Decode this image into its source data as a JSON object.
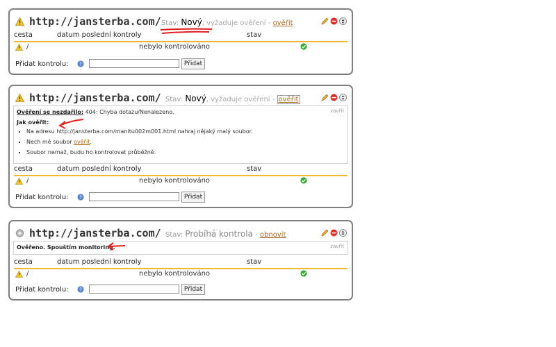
{
  "columns": {
    "path": "cesta",
    "last_check": "datum poslední kontroly",
    "state": "stav"
  },
  "add_check": {
    "label": "Přidat kontrolu:",
    "button": "Přidat",
    "input_value": ""
  },
  "colors": {
    "accent": "#f1b733",
    "link": "#a86a1e",
    "annotation": "#e0201e",
    "ok": "#3aaa35",
    "danger": "#d9302a"
  },
  "panels": [
    {
      "url": "http://jansterba.com/",
      "status_icon": "warning-icon",
      "state_label": "Stav:",
      "state_value": "Nový",
      "state_sep": ", vyžaduje ověření -",
      "state_action": "ověřit",
      "row": {
        "path": "/",
        "last_check": "nebylo kontrolováno"
      }
    },
    {
      "url": "http://jansterba.com/",
      "status_icon": "warning-icon",
      "state_label": "Stav:",
      "state_value": "Nový",
      "state_sep": ", vyžaduje ověření -",
      "state_action": "ověřit",
      "message": {
        "title": "Ověření se nezdařilo:",
        "error": "404: Chyba dotazu/Nenalezeno.",
        "close": "zavřít",
        "how_title": "Jak ověřit:",
        "steps": [
          "Na adresu http://jansterba.com/manitu002m001.html nahraj nějaký malý soubor.",
          "Nech mě soubor",
          "Soubor nemaž, budu ho kontrolovat průběžně."
        ],
        "step2_link": "ověřit",
        "step2_end": "."
      },
      "row": {
        "path": "/",
        "last_check": "nebylo kontrolováno"
      }
    },
    {
      "url": "http://jansterba.com/",
      "status_icon": "pending-icon",
      "state_label": "Stav:",
      "state_value": "Probíhá kontrola",
      "state_sep": "-",
      "state_action": "obnovit",
      "message": {
        "text": "Ověřeno. Spouštím monitoring.",
        "close": "zavřít"
      },
      "row": {
        "path": "/",
        "last_check": "nebylo kontrolováno"
      }
    }
  ]
}
